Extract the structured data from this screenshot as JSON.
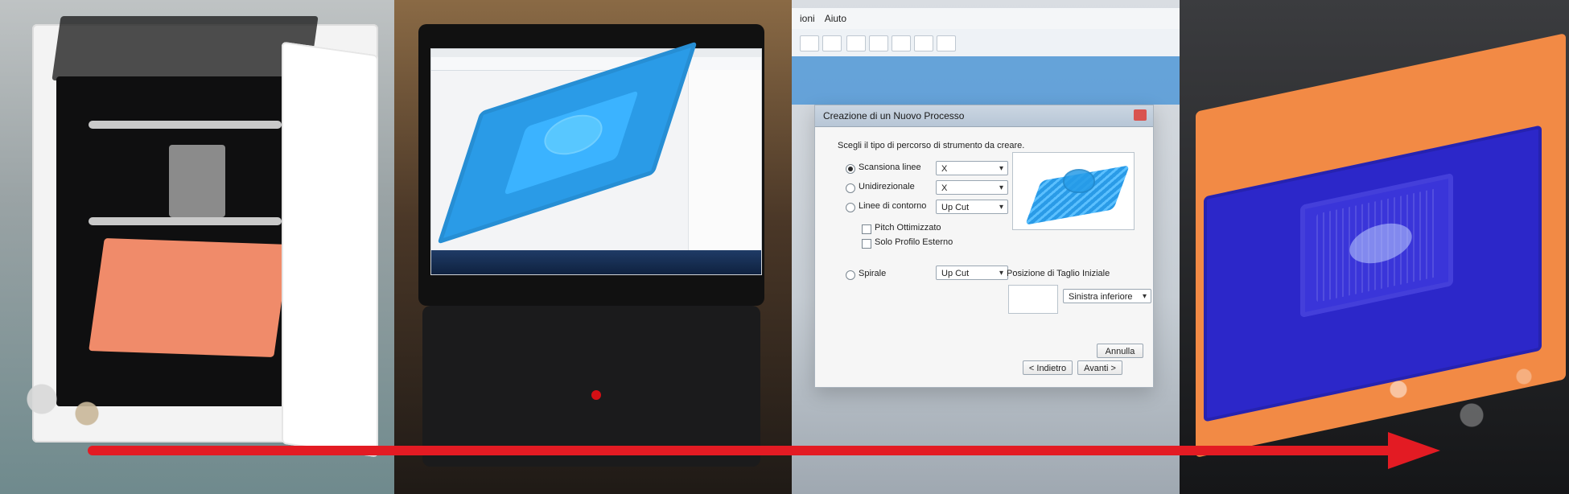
{
  "overlay": {
    "arrow_color": "#e31b23"
  },
  "panel3": {
    "menu": {
      "left": "ioni",
      "help": "Aiuto"
    },
    "dialog": {
      "title": "Creazione di un Nuovo Processo",
      "instruction": "Scegli il tipo di percorso di strumento da creare.",
      "options": {
        "scan_lines": "Scansiona linee",
        "unidirectional": "Unidirezionale",
        "contour_lines": "Linee di contorno",
        "spiral": "Spirale"
      },
      "selects": {
        "scan_lines_axis": "X",
        "unidirectional_axis": "X",
        "contour_cut": "Up Cut",
        "spiral_cut": "Up Cut",
        "start_position": "Sinistra inferiore"
      },
      "checkboxes": {
        "pitch_optimized": "Pitch Ottimizzato",
        "outer_profile_only": "Solo Profilo Esterno"
      },
      "start_position_label": "Posizione di Taglio Iniziale",
      "buttons": {
        "back": "< Indietro",
        "next": "Avanti >",
        "cancel": "Annulla"
      }
    }
  }
}
